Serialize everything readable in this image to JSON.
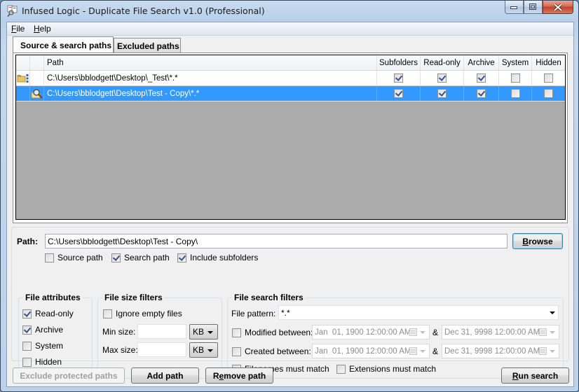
{
  "window": {
    "title": "Infused Logic - Duplicate File Search v1.0 (Professional)",
    "icon": "app-search-files-icon"
  },
  "menu": {
    "items": [
      {
        "label": "File",
        "mnemonic": "F",
        "rest": "ile"
      },
      {
        "label": "Help",
        "mnemonic": "H",
        "rest": "elp"
      }
    ]
  },
  "tabs": [
    {
      "label": "Source & search paths",
      "active": true
    },
    {
      "label": "Excluded paths",
      "active": false
    }
  ],
  "grid": {
    "columns": [
      "",
      "",
      "Path",
      "Subfolders",
      "Read-only",
      "Archive",
      "System",
      "Hidden"
    ],
    "rows": [
      {
        "icon": "source-folder-icon",
        "path": "C:\\Users\\bblodgett\\Desktop\\_Test\\*.*",
        "subfolders": true,
        "readonly": true,
        "archive": true,
        "system": false,
        "hidden": false,
        "selected": false
      },
      {
        "icon": "search-magnifier-icon",
        "path": "C:\\Users\\bblodgett\\Desktop\\Test - Copy\\*.*",
        "subfolders": true,
        "readonly": true,
        "archive": true,
        "system": false,
        "hidden": false,
        "selected": true
      }
    ]
  },
  "path_editor": {
    "label": "Path:",
    "value": "C:\\Users\\bblodgett\\Desktop\\Test - Copy\\",
    "browse_label": "Browse",
    "browse_mnemonic": "B",
    "browse_rest": "rowse",
    "source_path": {
      "label": "Source path",
      "checked": false
    },
    "search_path": {
      "label": "Search path",
      "checked": true
    },
    "include_subfolders": {
      "label": "Include subfolders",
      "checked": true
    }
  },
  "file_attributes": {
    "title": "File attributes",
    "items": [
      {
        "label": "Read-only",
        "checked": true
      },
      {
        "label": "Archive",
        "checked": true
      },
      {
        "label": "System",
        "checked": false
      },
      {
        "label": "Hidden",
        "checked": false
      }
    ]
  },
  "file_size_filters": {
    "title": "File size filters",
    "ignore_empty": {
      "label": "Ignore empty files",
      "checked": false
    },
    "min_label": "Min size:",
    "min_value": "",
    "min_unit": "KB",
    "max_label": "Max size:",
    "max_value": "",
    "max_unit": "KB"
  },
  "file_search_filters": {
    "title": "File search filters",
    "pattern_label": "File pattern:",
    "pattern_value": "*.*",
    "modified": {
      "label": "Modified between:",
      "checked": false,
      "from": "Jan  01, 1900 12:00:00 AM",
      "to": "Dec 31, 9998 12:00:00 AM"
    },
    "created": {
      "label": "Created between:",
      "checked": false,
      "from": "Jan  01, 1900 12:00:00 AM",
      "to": "Dec 31, 9998 12:00:00 AM"
    },
    "and_label": "&",
    "filenames_match": {
      "label": "Filenames must match",
      "checked": false
    },
    "extensions_match": {
      "label": "Extensions must match",
      "checked": false
    }
  },
  "buttons": {
    "exclude_protected": {
      "label": "Exclude protected paths",
      "enabled": false
    },
    "add_path": {
      "label": "Add path"
    },
    "remove_path": {
      "label": "Remove path",
      "pre": "R",
      "mnemonic": "e",
      "post": "move path"
    },
    "run_search": {
      "label": "Run search",
      "mnemonic": "R",
      "rest": "un search"
    }
  }
}
